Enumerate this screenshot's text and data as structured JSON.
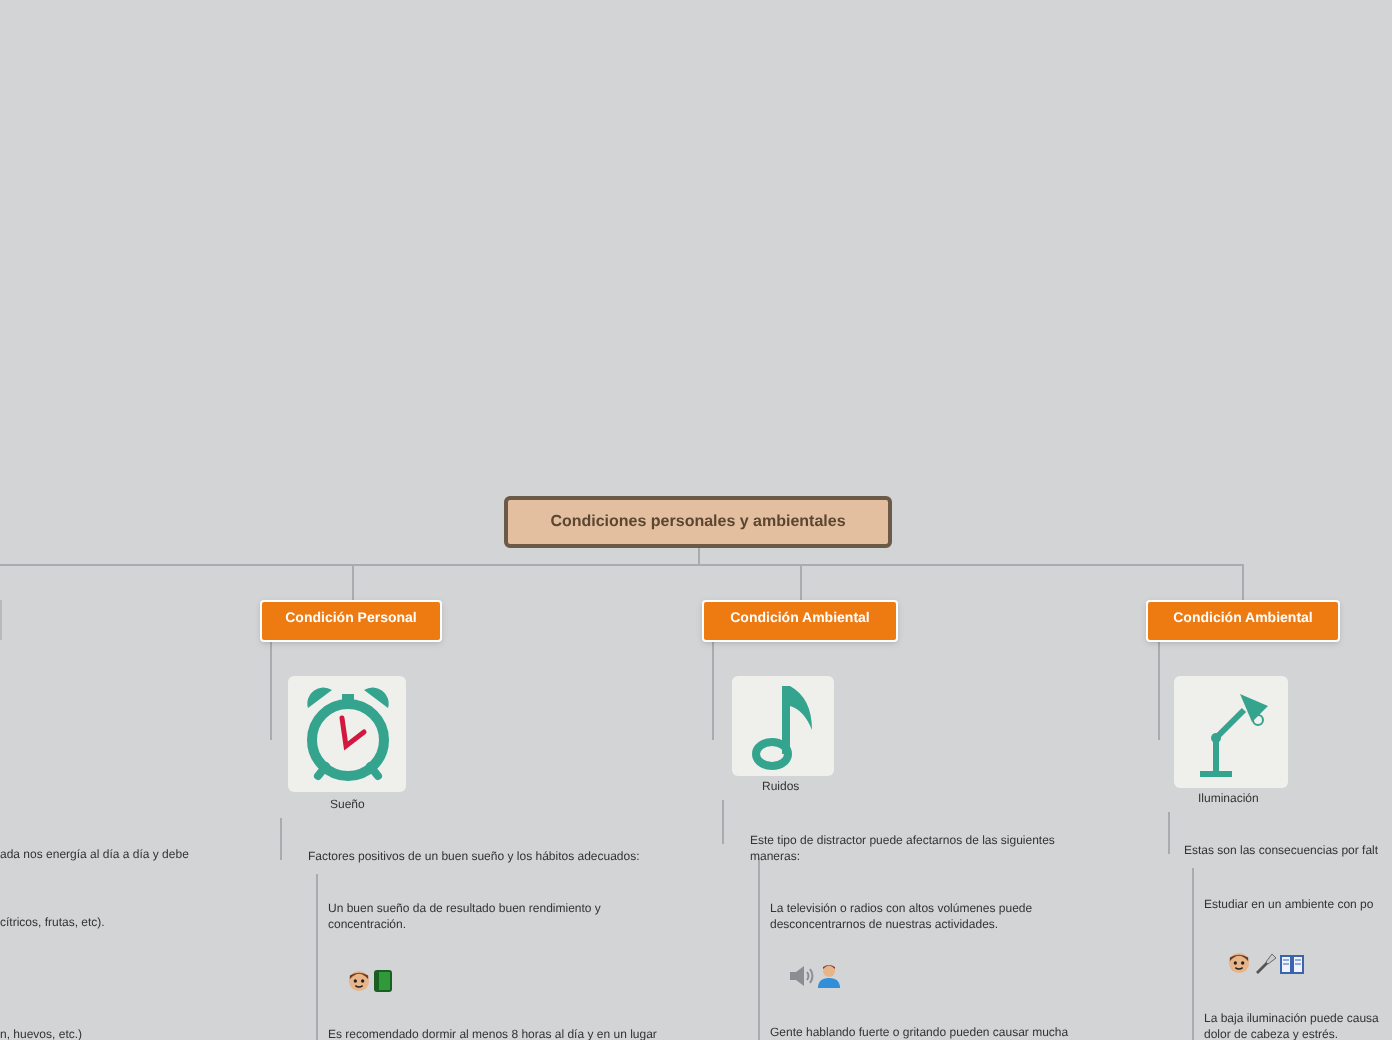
{
  "root": {
    "title": "Condiciones personales y ambientales"
  },
  "left_fragments": [
    "ada nos energía al día a día y debe",
    "cítricos, frutas, etc).",
    "n, huevos, etc.)"
  ],
  "branches": [
    {
      "kind": "clock",
      "title": "Condición Personal",
      "caption": "Sueño",
      "intro": "Factores positivos de un buen sueño y los hábitos adecuados:",
      "items": [
        {
          "lines": [
            "Un buen sueño da de resultado buen rendimiento y",
            "concentración."
          ]
        },
        {
          "lines": [
            "Es recomendado dormir al menos 8 horas al día y en un lugar"
          ]
        }
      ]
    },
    {
      "kind": "note",
      "title": "Condición Ambiental",
      "caption": "Ruidos",
      "intro": "Este tipo de distractor puede afectarnos de las siguientes maneras:",
      "items": [
        {
          "lines": [
            "La televisión o radios con altos volúmenes puede",
            "desconcentrarnos de nuestras actividades."
          ]
        },
        {
          "lines": [
            "Gente hablando fuerte o gritando pueden causar mucha"
          ]
        }
      ]
    },
    {
      "kind": "lamp",
      "title": "Condición Ambiental",
      "caption": "Iluminación",
      "intro": "Estas son las consecuencias por falt",
      "items": [
        {
          "lines": [
            "Estudiar en un ambiente con po"
          ]
        },
        {
          "lines": [
            "La baja iluminación puede causa",
            "dolor de cabeza y estrés."
          ]
        }
      ]
    }
  ]
}
